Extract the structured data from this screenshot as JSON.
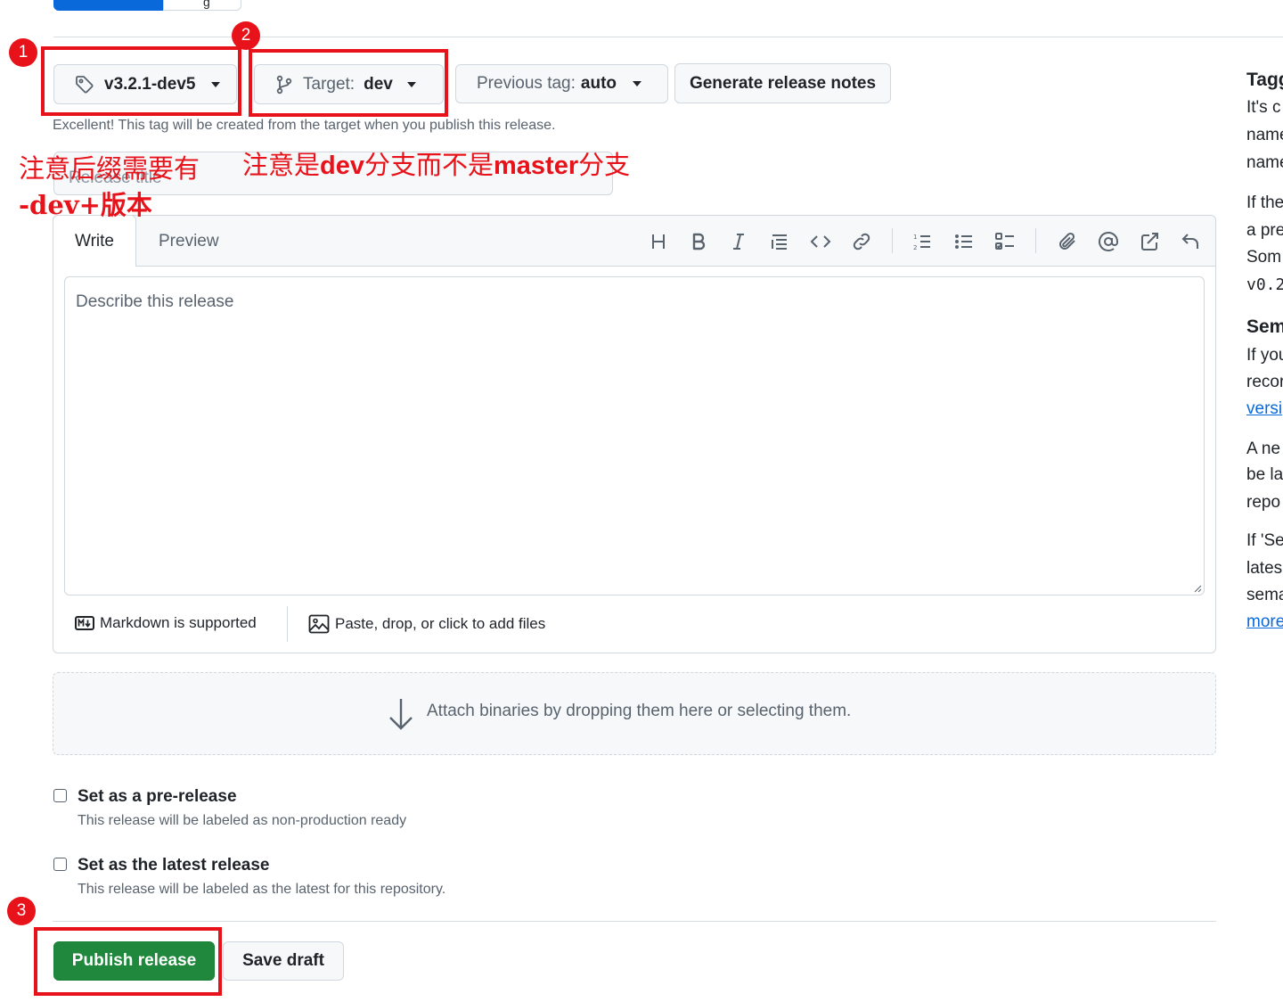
{
  "top_tabs": {
    "second_label": "g"
  },
  "tag_button": {
    "icon": "tag-icon",
    "label": "v3.2.1-dev5"
  },
  "target_button": {
    "icon": "git-branch-icon",
    "prefix": "Target:",
    "value": "dev"
  },
  "previous_tag_button": {
    "prefix": "Previous tag:",
    "value": "auto"
  },
  "generate_button": {
    "label": "Generate release notes"
  },
  "tag_helper": "Excellent! This tag will be created from the target when you publish this release.",
  "title_input": {
    "placeholder": "Release title"
  },
  "editor": {
    "tab_write": "Write",
    "tab_preview": "Preview",
    "placeholder": "Describe this release",
    "markdown_note": "Markdown is supported",
    "attach_note": "Paste, drop, or click to add files"
  },
  "attach_binaries": "Attach binaries by dropping them here or selecting them.",
  "prerelease": {
    "label": "Set as a pre-release",
    "description": "This release will be labeled as non-production ready",
    "checked": false
  },
  "latest": {
    "label": "Set as the latest release",
    "description": "This release will be labeled as the latest for this repository.",
    "checked": false
  },
  "publish_button": "Publish release",
  "save_draft_button": "Save draft",
  "annotations": {
    "badge1": "1",
    "badge2": "2",
    "badge3": "3",
    "note1_line1": "注意后缀需要有",
    "note1_line2": "-dev+版本",
    "note2_prefix": "注意是",
    "note2_bold1": "dev",
    "note2_mid": "分支而不是",
    "note2_bold2": "master",
    "note2_suffix": "分支",
    "color": "#e8131a"
  },
  "sidebar": {
    "lines": [
      "Tagg",
      "It's c",
      "name",
      "name",
      "If the",
      "a pre",
      "Som",
      "v0.2",
      "Sem",
      "If you",
      "recor",
      "versi",
      "A ne",
      "be la",
      "repo",
      "If 'Se",
      "lates",
      "sema",
      "more"
    ]
  },
  "colors": {
    "accent": "#0969da",
    "primary": "#1f883d",
    "annotation": "#e8131a"
  }
}
